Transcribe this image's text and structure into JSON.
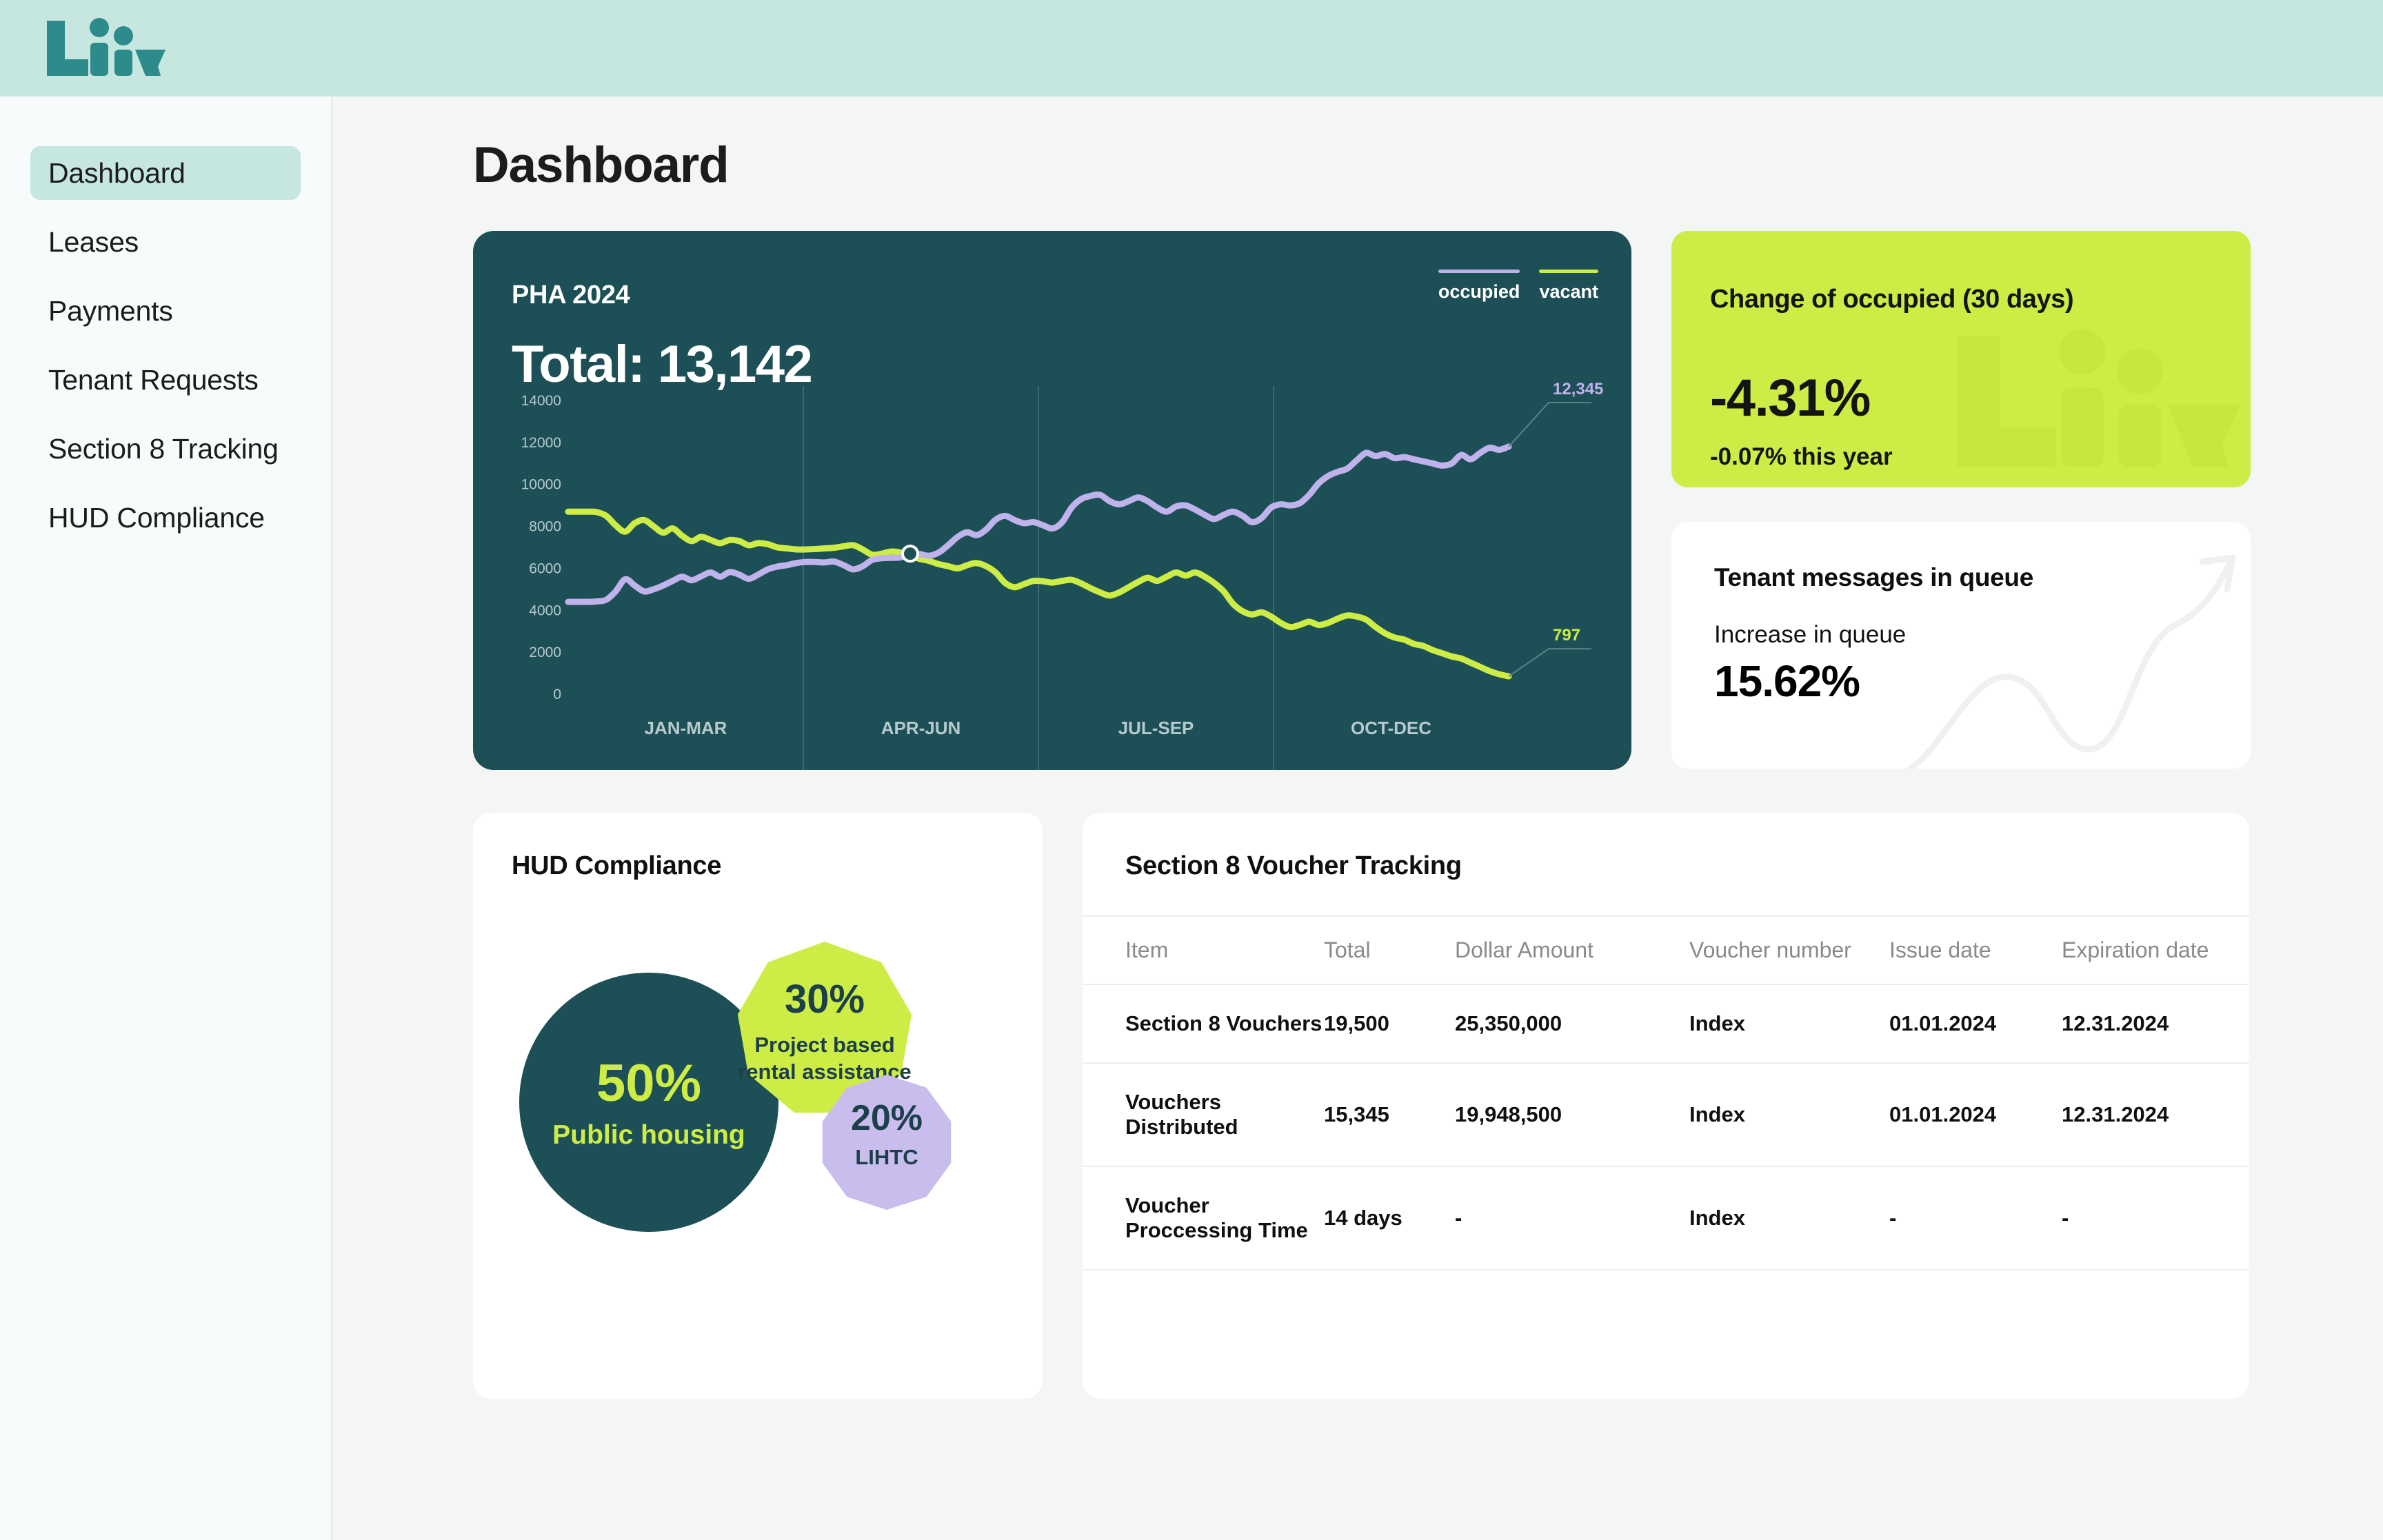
{
  "brand": {
    "name": "Liiv",
    "logo_color": "#2d8b8b",
    "topbar_color": "#c5e7e0"
  },
  "sidebar": {
    "items": [
      {
        "label": "Dashboard",
        "active": true
      },
      {
        "label": "Leases",
        "active": false
      },
      {
        "label": "Payments",
        "active": false
      },
      {
        "label": "Tenant Requests",
        "active": false
      },
      {
        "label": "Section 8 Tracking",
        "active": false
      },
      {
        "label": "HUD Compliance",
        "active": false
      }
    ]
  },
  "page": {
    "title": "Dashboard"
  },
  "hero_chart": {
    "kicker": "PHA 2024",
    "total_label": "Total: 13,142",
    "legend": [
      {
        "label": "occupied",
        "color": "#c0b2ea"
      },
      {
        "label": "vacant",
        "color": "#cdec45"
      }
    ],
    "end_label_occupied": "12,345",
    "end_label_vacant": "797"
  },
  "kpi_change": {
    "title": "Change of  occupied (30 days)",
    "value": "-4.31%",
    "sub": "-0.07% this year",
    "bg": "#cdec45"
  },
  "kpi_queue": {
    "title": "Tenant messages in queue",
    "sub": "Increase in queue",
    "value": "15.62%"
  },
  "hud_compliance": {
    "title": "HUD Compliance",
    "bubbles": [
      {
        "pct": "50%",
        "label": "Public housing",
        "fill": "#1d4f56",
        "text": "#cdec45"
      },
      {
        "pct": "30%",
        "label": "Project based\nrental assistance",
        "label_line1": "Project based",
        "label_line2": "rental assistance",
        "fill": "#cdec45",
        "text": "#1d3f4a"
      },
      {
        "pct": "20%",
        "label": "LIHTC",
        "fill": "#c9bdee",
        "text": "#1d3f4a"
      }
    ]
  },
  "voucher_tracking": {
    "title": "Section 8 Voucher Tracking",
    "columns": [
      "Item",
      "Total",
      "Dollar Amount",
      "Voucher number",
      "Issue date",
      "Expiration date"
    ],
    "rows": [
      {
        "item": "Section 8 Vouchers",
        "total": "19,500",
        "amount": "25,350,000",
        "voucher": "Index",
        "issue": "01.01.2024",
        "expiration": "12.31.2024"
      },
      {
        "item": "Vouchers Distributed",
        "total": "15,345",
        "amount": "19,948,500",
        "voucher": "Index",
        "issue": "01.01.2024",
        "expiration": "12.31.2024"
      },
      {
        "item": "Voucher Proccessing Time",
        "total": "14 days",
        "amount": "-",
        "voucher": "Index",
        "issue": "-",
        "expiration": "-"
      }
    ]
  },
  "chart_data": {
    "type": "line",
    "title": "PHA 2024",
    "xlabel": "",
    "ylabel": "",
    "ylim": [
      0,
      14000
    ],
    "yticks": [
      0,
      2000,
      4000,
      6000,
      8000,
      10000,
      12000,
      14000
    ],
    "ytick_labels": [
      "0",
      "2000",
      "4000",
      "6000",
      "8000",
      "10000",
      "12000",
      "14000"
    ],
    "categories": [
      "JAN-MAR",
      "APR-JUN",
      "JUL-SEP",
      "OCT-DEC"
    ],
    "grid": "vertical-quarter-dividers",
    "legend_position": "top-right",
    "annotations": [
      {
        "series": "occupied",
        "text": "12,345",
        "at": "end"
      },
      {
        "series": "vacant",
        "text": "797",
        "at": "end"
      },
      {
        "series": "crossover",
        "text": "",
        "at": "mid-Q2"
      }
    ],
    "series": [
      {
        "name": "occupied",
        "color": "#c0b2ea",
        "values": [
          4400,
          4400,
          4400,
          4420,
          4500,
          4900,
          5480,
          5180,
          4900,
          5000,
          5180,
          5400,
          5600,
          5430,
          5620,
          5800,
          5600,
          5820,
          5700,
          5500,
          5700,
          5950,
          6080,
          6150,
          6250,
          6300,
          6300,
          6280,
          6320,
          6150,
          5950,
          6100,
          6400,
          6480,
          6500,
          6520,
          6700,
          6680,
          6600,
          6750,
          7100,
          7500,
          7720,
          7580,
          7850,
          8320,
          8500,
          8300,
          8150,
          8200,
          8050,
          7900,
          8200,
          8900,
          9300,
          9450,
          9500,
          9200,
          9050,
          9200,
          9380,
          9200,
          8900,
          8700,
          8950,
          9000,
          8800,
          8550,
          8350,
          8550,
          8700,
          8500,
          8200,
          8400,
          8900,
          9050,
          9000,
          9100,
          9500,
          10050,
          10400,
          10600,
          10750,
          11150,
          11500,
          11350,
          11450,
          11250,
          11300,
          11200,
          11100,
          11000,
          10900,
          11000,
          11400,
          11200,
          11500,
          11750,
          11650,
          11800
        ]
      },
      {
        "name": "vacant",
        "color": "#cdec45",
        "values": [
          8700,
          8700,
          8700,
          8680,
          8500,
          8050,
          7750,
          8150,
          8300,
          8000,
          7700,
          7900,
          7550,
          7300,
          7500,
          7350,
          7200,
          7350,
          7300,
          7100,
          7200,
          7150,
          7000,
          6950,
          6900,
          6900,
          6920,
          6950,
          6980,
          7050,
          7100,
          6900,
          6650,
          6700,
          6800,
          6750,
          6600,
          6450,
          6350,
          6200,
          6100,
          6000,
          6150,
          6250,
          6100,
          5800,
          5300,
          5100,
          5250,
          5400,
          5380,
          5320,
          5400,
          5450,
          5280,
          5050,
          4850,
          4700,
          4850,
          5100,
          5350,
          5550,
          5400,
          5600,
          5800,
          5650,
          5800,
          5600,
          5300,
          4900,
          4300,
          3950,
          3800,
          3900,
          3700,
          3400,
          3200,
          3300,
          3450,
          3300,
          3400,
          3600,
          3750,
          3700,
          3550,
          3200,
          2900,
          2700,
          2600,
          2400,
          2300,
          2100,
          1950,
          1800,
          1700,
          1500,
          1300,
          1100,
          950,
          850
        ]
      }
    ]
  }
}
